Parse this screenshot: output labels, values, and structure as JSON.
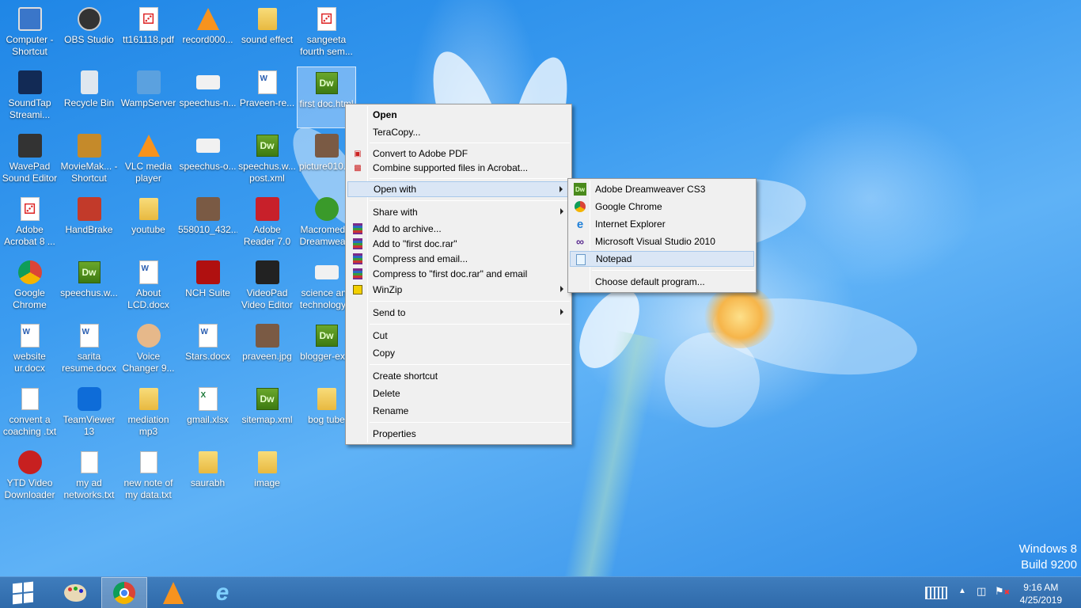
{
  "desktop": {
    "icons": [
      {
        "label": "Computer - Shortcut",
        "icon": "computer-icon"
      },
      {
        "label": "OBS Studio",
        "icon": "obs-icon"
      },
      {
        "label": "tt161118.pdf",
        "icon": "pdf-icon"
      },
      {
        "label": "record000...",
        "icon": "vlc-icon"
      },
      {
        "label": "sound effect",
        "icon": "folder-icon"
      },
      {
        "label": "sangeeta fourth sem...",
        "icon": "pdf-icon"
      },
      {
        "label": "SoundTap Streami...",
        "icon": "soundtap-icon"
      },
      {
        "label": "Recycle Bin",
        "icon": "recycle-bin-icon"
      },
      {
        "label": "WampServer",
        "icon": "wamp-icon"
      },
      {
        "label": "speechus-n...",
        "icon": "image-icon"
      },
      {
        "label": "Praveen-re...",
        "icon": "document-icon"
      },
      {
        "label": "first doc.html",
        "icon": "dreamweaver-icon"
      },
      {
        "label": "WavePad Sound Editor",
        "icon": "wavepad-icon"
      },
      {
        "label": "MovieMak... - Shortcut",
        "icon": "moviemaker-icon"
      },
      {
        "label": "VLC media player",
        "icon": "vlc-icon"
      },
      {
        "label": "speechus-o...",
        "icon": "image-icon"
      },
      {
        "label": "speechus.w... post.xml",
        "icon": "dreamweaver-icon"
      },
      {
        "label": "picture010....",
        "icon": "photo-icon"
      },
      {
        "label": "Adobe Acrobat 8 ...",
        "icon": "acrobat-icon"
      },
      {
        "label": "HandBrake",
        "icon": "handbrake-icon"
      },
      {
        "label": "youtube",
        "icon": "folder-icon"
      },
      {
        "label": "558010_432...",
        "icon": "photo-icon"
      },
      {
        "label": "Adobe Reader 7.0",
        "icon": "reader-icon"
      },
      {
        "label": "Macromedia Dreamwea...",
        "icon": "macromedia-icon"
      },
      {
        "label": "Google Chrome",
        "icon": "chrome-icon"
      },
      {
        "label": "speechus.w...",
        "icon": "dreamweaver-icon"
      },
      {
        "label": "About LCD.docx",
        "icon": "document-icon"
      },
      {
        "label": "NCH Suite",
        "icon": "nch-icon"
      },
      {
        "label": "VideoPad Video Editor",
        "icon": "videopad-icon"
      },
      {
        "label": "science and technology...",
        "icon": "image-icon"
      },
      {
        "label": "website ur.docx",
        "icon": "document-icon"
      },
      {
        "label": "sarita resume.docx",
        "icon": "document-icon"
      },
      {
        "label": "Voice Changer 9...",
        "icon": "voice-changer-icon"
      },
      {
        "label": "Stars.docx",
        "icon": "document-icon"
      },
      {
        "label": "praveen.jpg",
        "icon": "photo-icon"
      },
      {
        "label": "blogger-ex...",
        "icon": "dreamweaver-icon"
      },
      {
        "label": "convent a coaching .txt",
        "icon": "text-file-icon"
      },
      {
        "label": "TeamViewer 13",
        "icon": "teamviewer-icon"
      },
      {
        "label": "mediation mp3",
        "icon": "folder-icon"
      },
      {
        "label": "gmail.xlsx",
        "icon": "excel-icon"
      },
      {
        "label": "sitemap.xml",
        "icon": "dreamweaver-icon"
      },
      {
        "label": "bog tube",
        "icon": "folder-icon"
      },
      {
        "label": "YTD Video Downloader",
        "icon": "ytd-icon"
      },
      {
        "label": "my ad networks.txt",
        "icon": "text-file-icon"
      },
      {
        "label": "new note of my data.txt",
        "icon": "text-file-icon"
      },
      {
        "label": "saurabh",
        "icon": "folder-icon"
      },
      {
        "label": "image",
        "icon": "folder-icon"
      }
    ]
  },
  "context_menu": {
    "open": "Open",
    "teracopy": "TeraCopy...",
    "convert_pdf": "Convert to Adobe PDF",
    "combine_acrobat": "Combine supported files in Acrobat...",
    "open_with": "Open with",
    "share_with": "Share with",
    "add_archive": "Add to archive...",
    "add_rar": "Add to \"first doc.rar\"",
    "compress_email": "Compress and email...",
    "compress_rar_email": "Compress to \"first doc.rar\" and email",
    "winzip": "WinZip",
    "send_to": "Send to",
    "cut": "Cut",
    "copy": "Copy",
    "create_shortcut": "Create shortcut",
    "delete": "Delete",
    "rename": "Rename",
    "properties": "Properties"
  },
  "open_with_menu": {
    "dreamweaver": "Adobe Dreamweaver CS3",
    "chrome": "Google Chrome",
    "ie": "Internet Explorer",
    "visual_studio": "Microsoft Visual Studio 2010",
    "notepad": "Notepad",
    "choose_default": "Choose default program..."
  },
  "watermark": {
    "line1": "Windows 8",
    "line2": "Build 9200"
  },
  "taskbar": {
    "time": "9:16 AM",
    "date": "4/25/2019"
  },
  "colors": {
    "menu_highlight": "#dae6f5",
    "taskbar": "#2f6aaa"
  }
}
